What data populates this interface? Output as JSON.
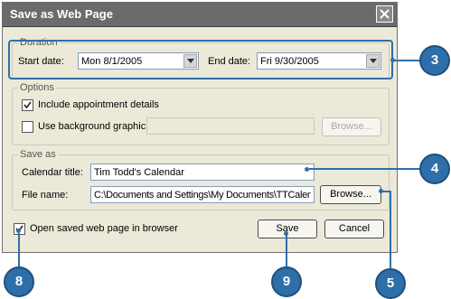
{
  "dialog": {
    "title": "Save as Web Page",
    "close_icon": "close-icon"
  },
  "duration": {
    "legend": "Duration",
    "start_label": "Start date:",
    "start_value": "Mon 8/1/2005",
    "end_label": "End date:",
    "end_value": "Fri 9/30/2005"
  },
  "options": {
    "legend": "Options",
    "include_details_label": "Include appointment details",
    "include_details_checked": true,
    "background_label": "Use background graphic:",
    "background_checked": false,
    "background_value": "",
    "browse_label": "Browse..."
  },
  "save_as": {
    "legend": "Save as",
    "title_label": "Calendar title:",
    "title_value": "Tim Todd's Calendar",
    "file_label": "File name:",
    "file_value": "C:\\Documents and Settings\\My Documents\\TTCalendar",
    "browse_label": "Browse..."
  },
  "footer": {
    "open_browser_label": "Open saved web page in browser",
    "open_browser_checked": true,
    "save_label": "Save",
    "cancel_label": "Cancel"
  },
  "callouts": [
    "3",
    "4",
    "5",
    "8",
    "9"
  ],
  "colors": {
    "callout": "#2e6fa9",
    "titlebar": "#6b6b6b",
    "dialog_bg": "#ECE9D8"
  }
}
